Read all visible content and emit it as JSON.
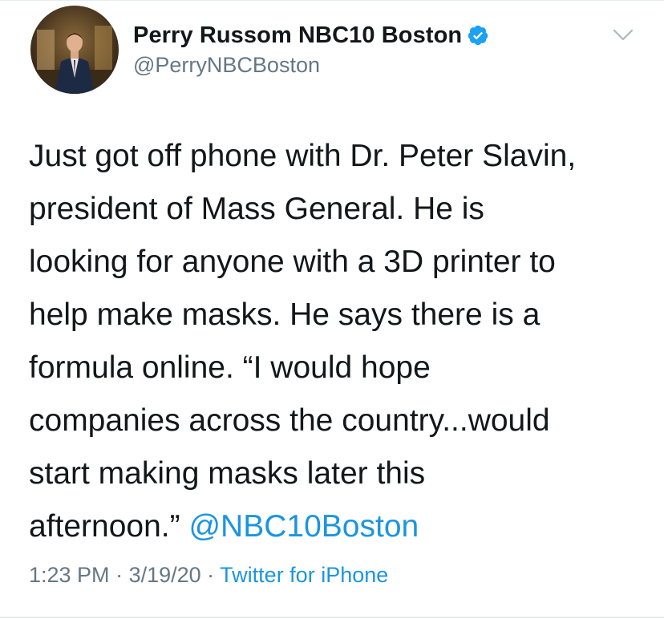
{
  "author": {
    "display_name": "Perry Russom NBC10 Boston",
    "handle": "@PerryNBCBoston",
    "verified": true
  },
  "tweet": {
    "lines": [
      "Just got off phone with Dr. Peter Slavin,",
      "president of Mass General. He is",
      "looking for anyone with a 3D printer to",
      "help make masks. He says there is a",
      "formula online. “I would hope",
      "companies across the country...would",
      "start making masks later this"
    ],
    "last_line_text": "afternoon.” ",
    "mention": "@NBC10Boston"
  },
  "meta": {
    "time": "1:23 PM",
    "separator": " · ",
    "date": "3/19/20",
    "source": "Twitter for iPhone"
  },
  "icons": {
    "verified": "verified-badge-icon",
    "menu": "chevron-down-icon"
  },
  "colors": {
    "text": "#14171a",
    "secondary": "#657786",
    "link": "#1b95e0",
    "verified": "#1da1f2"
  }
}
